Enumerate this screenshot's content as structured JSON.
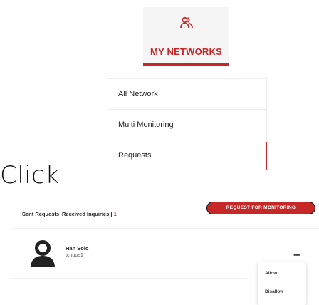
{
  "networks": {
    "title": "MY NETWORKS",
    "icon": "users-icon",
    "accent_color": "#c62828"
  },
  "menu": {
    "items": [
      {
        "label": "All Network"
      },
      {
        "label": "Multi Monitoring"
      },
      {
        "label": "Requests",
        "active": true
      }
    ]
  },
  "annotation": {
    "text": "Click"
  },
  "tabs": {
    "sent": "Sent Requests",
    "received": "Received Inquiries",
    "received_separator": " | ",
    "received_count": "1",
    "active": "received"
  },
  "actions": {
    "request_monitoring": "REQUEST FOR MONITORING"
  },
  "rows": [
    {
      "name": "Han Solo",
      "handle": "tchupe1",
      "avatar_icon": "user-avatar-icon",
      "more_icon": "more-horizontal-icon"
    }
  ],
  "dropdown": {
    "allow": "Allow",
    "disallow": "Disallow"
  }
}
